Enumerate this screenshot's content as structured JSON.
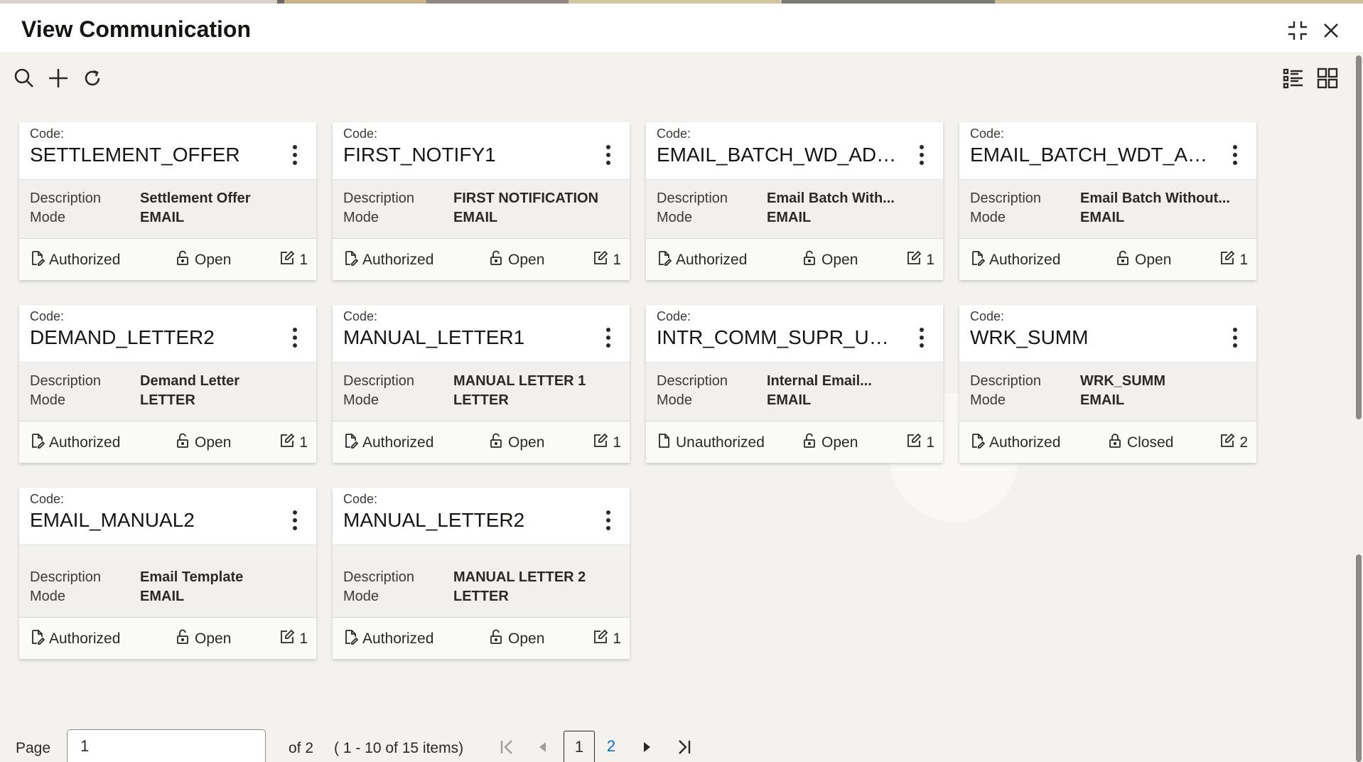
{
  "window": {
    "title": "View Communication"
  },
  "header_icons": {
    "collapse": "collapse-icon",
    "close": "close-icon"
  },
  "toolbar": {
    "search": "search-icon",
    "add": "add-icon",
    "refresh": "refresh-icon",
    "list_view": "list-view-icon",
    "card_view": "card-view-icon"
  },
  "labels": {
    "code": "Code:",
    "description": "Description",
    "mode": "Mode"
  },
  "cards": [
    {
      "code": "SETTLEMENT_OFFER",
      "description": "Settlement Offer",
      "mode": "EMAIL",
      "auth": "Authorized",
      "lock": "Open",
      "version": "1"
    },
    {
      "code": "FIRST_NOTIFY1",
      "description": "FIRST NOTIFICATION",
      "mode": "EMAIL",
      "auth": "Authorized",
      "lock": "Open",
      "version": "1"
    },
    {
      "code": "EMAIL_BATCH_WD_ADVC",
      "description": "Email Batch With...",
      "mode": "EMAIL",
      "auth": "Authorized",
      "lock": "Open",
      "version": "1"
    },
    {
      "code": "EMAIL_BATCH_WDT_ADVC",
      "description": "Email Batch Without...",
      "mode": "EMAIL",
      "auth": "Authorized",
      "lock": "Open",
      "version": "1"
    },
    {
      "code": "DEMAND_LETTER2",
      "description": "Demand Letter",
      "mode": "LETTER",
      "auth": "Authorized",
      "lock": "Open",
      "version": "1"
    },
    {
      "code": "MANUAL_LETTER1",
      "description": "MANUAL LETTER 1",
      "mode": "LETTER",
      "auth": "Authorized",
      "lock": "Open",
      "version": "1"
    },
    {
      "code": "INTR_COMM_SUPR_USR_...",
      "description": "Internal Email...",
      "mode": "EMAIL",
      "auth": "Unauthorized",
      "lock": "Open",
      "version": "1"
    },
    {
      "code": "WRK_SUMM",
      "description": "WRK_SUMM",
      "mode": "EMAIL",
      "auth": "Authorized",
      "lock": "Closed",
      "version": "2"
    },
    {
      "code": "EMAIL_MANUAL2",
      "description": "Email Template",
      "mode": "EMAIL",
      "auth": "Authorized",
      "lock": "Open",
      "version": "1"
    },
    {
      "code": "MANUAL_LETTER2",
      "description": "MANUAL LETTER 2",
      "mode": "LETTER",
      "auth": "Authorized",
      "lock": "Open",
      "version": "1"
    }
  ],
  "pagination": {
    "page_label": "Page",
    "page_value": "1",
    "of_text": "of 2",
    "items_text": "( 1 - 10 of 15 items)",
    "pages": [
      "1",
      "2"
    ],
    "current_page": "1"
  },
  "colors": {
    "accent": "#0572ce",
    "text": "#161513",
    "card_body": "#f1f0ee"
  }
}
